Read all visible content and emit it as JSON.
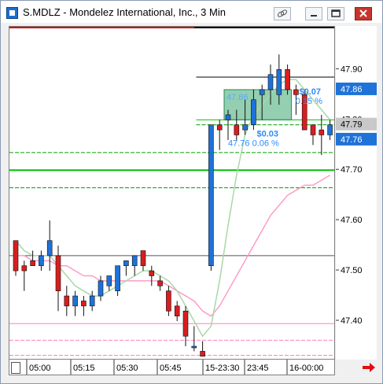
{
  "window": {
    "title": "S.MDLZ - Mondelez International, Inc., 3 Min",
    "buttons": [
      "link-icon",
      "minimize-icon",
      "maximize-icon",
      "close-icon"
    ]
  },
  "price_axis": {
    "ticks": [
      "47.90",
      "47.80",
      "47.70",
      "47.60",
      "47.50",
      "47.40"
    ],
    "tags": [
      {
        "label": "47.86",
        "bg": "#1e72d8",
        "fg": "#ffffff"
      },
      {
        "label": "47.79",
        "bg": "#c8c8c8",
        "fg": "#000000"
      },
      {
        "label": "47.76",
        "bg": "#1e72d8",
        "fg": "#ffffff"
      }
    ]
  },
  "time_axis": {
    "labels": [
      "05:00",
      "05:15",
      "05:30",
      "05:45",
      "15-23:30",
      "23:45",
      "16-00:00"
    ]
  },
  "annotations": {
    "upper": {
      "price": "47.86",
      "change": "$0.07",
      "pct": "0.15 %"
    },
    "lower": {
      "price": "47.76",
      "change": "$0.03",
      "pct": "0.06 %"
    }
  },
  "colors": {
    "up": "#1e72d8",
    "down": "#d81e1e",
    "green_line": "#00c000",
    "pink_line": "#ff80c0",
    "ma_fast": "#a8d8a8",
    "ma_slow": "#ff9cc8",
    "box_fill": "#3aa870"
  },
  "chart_data": {
    "type": "candlestick",
    "ylim": [
      47.325,
      47.985
    ],
    "candles": [
      {
        "o": 47.56,
        "h": 47.56,
        "l": 47.49,
        "c": 47.5
      },
      {
        "o": 47.51,
        "h": 47.52,
        "l": 47.46,
        "c": 47.5
      },
      {
        "o": 47.52,
        "h": 47.54,
        "l": 47.51,
        "c": 47.51
      },
      {
        "o": 47.51,
        "h": 47.54,
        "l": 47.5,
        "c": 47.53
      },
      {
        "o": 47.53,
        "h": 47.6,
        "l": 47.5,
        "c": 47.56
      },
      {
        "o": 47.53,
        "h": 47.55,
        "l": 47.42,
        "c": 47.46
      },
      {
        "o": 47.45,
        "h": 47.47,
        "l": 47.41,
        "c": 47.43
      },
      {
        "o": 47.43,
        "h": 47.46,
        "l": 47.41,
        "c": 47.45
      },
      {
        "o": 47.44,
        "h": 47.45,
        "l": 47.41,
        "c": 47.43
      },
      {
        "o": 47.43,
        "h": 47.46,
        "l": 47.42,
        "c": 47.45
      },
      {
        "o": 47.45,
        "h": 47.49,
        "l": 47.44,
        "c": 47.48
      },
      {
        "o": 47.47,
        "h": 47.49,
        "l": 47.46,
        "c": 47.49
      },
      {
        "o": 47.46,
        "h": 47.51,
        "l": 47.45,
        "c": 47.51
      },
      {
        "o": 47.51,
        "h": 47.52,
        "l": 47.49,
        "c": 47.52
      },
      {
        "o": 47.51,
        "h": 47.53,
        "l": 47.49,
        "c": 47.53
      },
      {
        "o": 47.54,
        "h": 47.54,
        "l": 47.5,
        "c": 47.51
      },
      {
        "o": 47.5,
        "h": 47.51,
        "l": 47.47,
        "c": 47.49
      },
      {
        "o": 47.48,
        "h": 47.49,
        "l": 47.46,
        "c": 47.47
      },
      {
        "o": 47.46,
        "h": 47.47,
        "l": 47.41,
        "c": 47.42
      },
      {
        "o": 47.43,
        "h": 47.44,
        "l": 47.4,
        "c": 47.41
      },
      {
        "o": 47.42,
        "h": 47.43,
        "l": 47.35,
        "c": 47.37
      },
      {
        "o": 47.35,
        "h": 47.39,
        "l": 47.34,
        "c": 47.35
      },
      {
        "o": 47.34,
        "h": 47.36,
        "l": 47.33,
        "c": 47.33
      },
      {
        "o": 47.51,
        "h": 47.79,
        "l": 47.5,
        "c": 47.79
      },
      {
        "o": 47.79,
        "h": 47.8,
        "l": 47.74,
        "c": 47.78
      },
      {
        "o": 47.8,
        "h": 47.82,
        "l": 47.76,
        "c": 47.81
      },
      {
        "o": 47.79,
        "h": 47.82,
        "l": 47.76,
        "c": 47.77
      },
      {
        "o": 47.78,
        "h": 47.84,
        "l": 47.77,
        "c": 47.79
      },
      {
        "o": 47.79,
        "h": 47.86,
        "l": 47.78,
        "c": 47.84
      },
      {
        "o": 47.85,
        "h": 47.87,
        "l": 47.8,
        "c": 47.86
      },
      {
        "o": 47.86,
        "h": 47.91,
        "l": 47.83,
        "c": 47.89
      },
      {
        "o": 47.85,
        "h": 47.93,
        "l": 47.83,
        "c": 47.9
      },
      {
        "o": 47.9,
        "h": 47.91,
        "l": 47.85,
        "c": 47.86
      },
      {
        "o": 47.86,
        "h": 47.87,
        "l": 47.81,
        "c": 47.85
      },
      {
        "o": 47.85,
        "h": 47.86,
        "l": 47.78,
        "c": 47.78
      },
      {
        "o": 47.79,
        "h": 47.79,
        "l": 47.75,
        "c": 47.77
      },
      {
        "o": 47.78,
        "h": 47.81,
        "l": 47.73,
        "c": 47.77
      },
      {
        "o": 47.77,
        "h": 47.8,
        "l": 47.76,
        "c": 47.79
      }
    ],
    "hlines": [
      {
        "y": 47.885,
        "color": "#000000",
        "style": "solid",
        "from": 0.575
      },
      {
        "y": 47.8,
        "color": "#00c000",
        "style": "solid",
        "from": 0.575
      },
      {
        "y": 47.79,
        "color": "#00a000",
        "style": "dashed",
        "from": 0.575
      },
      {
        "y": 47.735,
        "color": "#00a000",
        "style": "dashed",
        "from": 0
      },
      {
        "y": 47.7,
        "color": "#00c000",
        "style": "solid-thick",
        "from": 0
      },
      {
        "y": 47.665,
        "color": "#00a000",
        "style": "dashed",
        "from": 0
      },
      {
        "y": 47.53,
        "color": "#555555",
        "style": "solid",
        "from": 0
      },
      {
        "y": 47.395,
        "color": "#ff80c0",
        "style": "solid",
        "from": 0
      },
      {
        "y": 47.362,
        "color": "#ff80c0",
        "style": "dashed",
        "from": 0
      },
      {
        "y": 47.332,
        "color": "#ff80c0",
        "style": "dashed",
        "from": 0
      }
    ],
    "ma_fast": [
      47.56,
      47.54,
      47.53,
      47.53,
      47.53,
      47.51,
      47.49,
      47.47,
      47.46,
      47.45,
      47.45,
      47.46,
      47.47,
      47.48,
      47.49,
      47.5,
      47.5,
      47.49,
      47.48,
      47.46,
      47.43,
      47.4,
      47.37,
      47.39,
      47.48,
      47.59,
      47.69,
      47.77,
      47.81,
      47.83,
      47.85,
      47.87,
      47.88,
      47.88,
      47.86,
      47.84,
      47.82,
      47.8
    ],
    "ma_slow": [
      47.53,
      47.53,
      47.52,
      47.52,
      47.52,
      47.51,
      47.51,
      47.5,
      47.49,
      47.49,
      47.48,
      47.48,
      47.48,
      47.48,
      47.48,
      47.48,
      47.48,
      47.48,
      47.47,
      47.46,
      47.45,
      47.44,
      47.42,
      47.41,
      47.43,
      47.46,
      47.49,
      47.52,
      47.55,
      47.58,
      47.61,
      47.63,
      47.65,
      47.66,
      47.67,
      47.67,
      47.68,
      47.69
    ],
    "box": {
      "x0": 25,
      "x1": 32,
      "y0": 47.86,
      "y1": 47.8
    }
  }
}
